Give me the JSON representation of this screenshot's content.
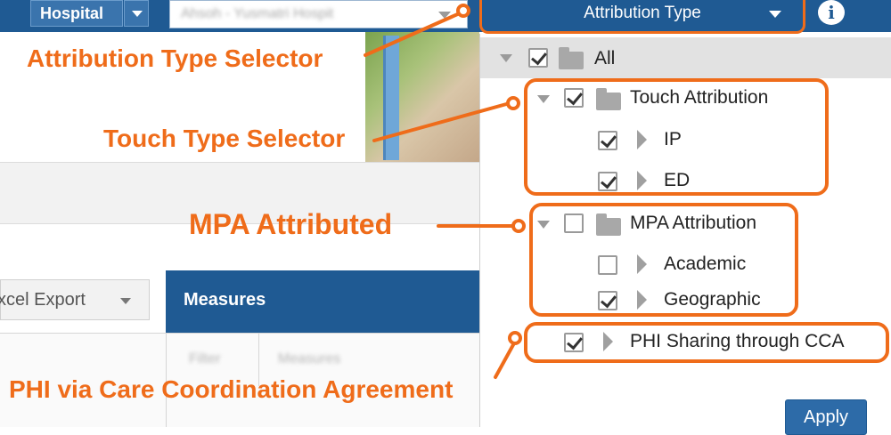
{
  "topbar": {
    "hospital_label": "Hospital",
    "facility_placeholder": "Ahsoh - Yusmatri Hospit",
    "attribution_type_label": "Attribution Type",
    "info_symbol": "i"
  },
  "page": {
    "excel_export_label": "xcel Export",
    "measures_header": "Measures",
    "filter_cell": "Filter",
    "measures_cell": "Measures"
  },
  "dropdown": {
    "all": {
      "label": "All",
      "checked": true
    },
    "touch": {
      "label": "Touch Attribution",
      "checked": true,
      "children": [
        {
          "label": "IP",
          "checked": true
        },
        {
          "label": "ED",
          "checked": true
        }
      ]
    },
    "mpa": {
      "label": "MPA Attribution",
      "checked": false,
      "children": [
        {
          "label": "Academic",
          "checked": false
        },
        {
          "label": "Geographic",
          "checked": true
        }
      ]
    },
    "phi": {
      "label": "PHI Sharing through CCA",
      "checked": true
    },
    "apply_label": "Apply"
  },
  "callouts": {
    "attribution_type_selector": "Attribution Type Selector",
    "touch_type_selector": "Touch Type Selector",
    "mpa_attributed": "MPA Attributed",
    "phi_via_cca": "PHI via Care Coordination Agreement"
  },
  "colors": {
    "accent": "#ef6c1a",
    "header_blue": "#1f5a93",
    "apply_blue": "#2d6ba8"
  }
}
